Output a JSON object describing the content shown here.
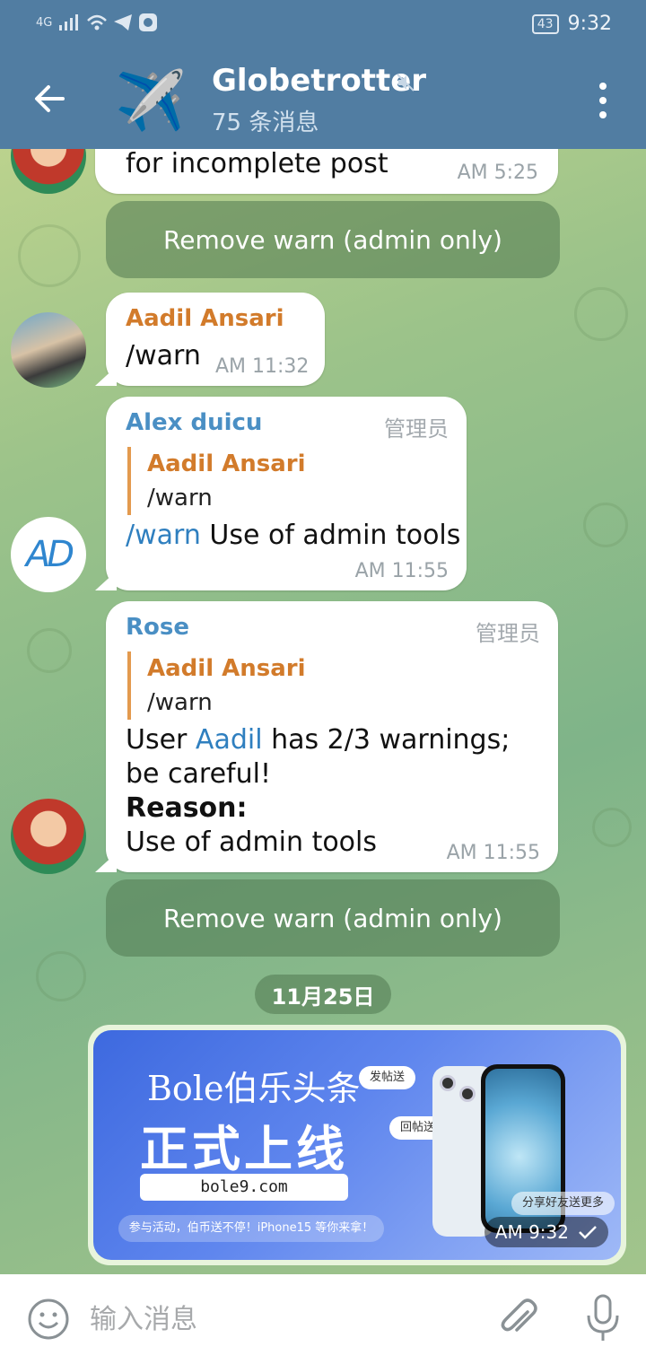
{
  "status_bar": {
    "network": "4G",
    "battery": "43",
    "time": "9:32"
  },
  "header": {
    "group_emoji": "✈️",
    "title": "Globetrotter",
    "subtitle": "75 条消息",
    "icons": [
      "back-arrow-icon",
      "muted-icon",
      "more-vert-icon"
    ]
  },
  "messages": [
    {
      "text": "for incomplete post",
      "time": "AM 5:25",
      "button": "Remove warn (admin only)"
    },
    {
      "sender": "Aadil Ansari",
      "text": "/warn",
      "time": "AM 11:32"
    },
    {
      "sender": "Alex duicu",
      "badge": "管理员",
      "reply_name": "Aadil Ansari",
      "reply_text": "/warn",
      "command": "/warn",
      "text": " Use of admin tools",
      "time": "AM 11:55",
      "avatar_text": "AD"
    },
    {
      "sender": "Rose",
      "badge": "管理员",
      "reply_name": "Aadil Ansari",
      "reply_text": "/warn",
      "line1_pre": "User ",
      "line1_link": "Aadil",
      "line1_post": " has 2/3 warnings; be careful!",
      "reason_label": "Reason:",
      "reason_text": "Use of admin tools",
      "time": "AM 11:55",
      "button": "Remove warn (admin only)"
    }
  ],
  "date_divider": "11月25日",
  "ad": {
    "brand": "Bole伯乐头条",
    "headline": "正式上线",
    "url": "bole9.com",
    "footer": "参与活动，伯币送不停！iPhone15 等你来拿！",
    "chip_post": "发帖送",
    "chip_reply": "回帖送",
    "chip_share": "分享好友送更多",
    "time": "AM 9:32"
  },
  "composer": {
    "placeholder": "输入消息"
  },
  "colors": {
    "header": "#517da2",
    "sender_orange": "#d27b2b",
    "sender_blue": "#4a8fc4",
    "link": "#2f7fbf"
  }
}
